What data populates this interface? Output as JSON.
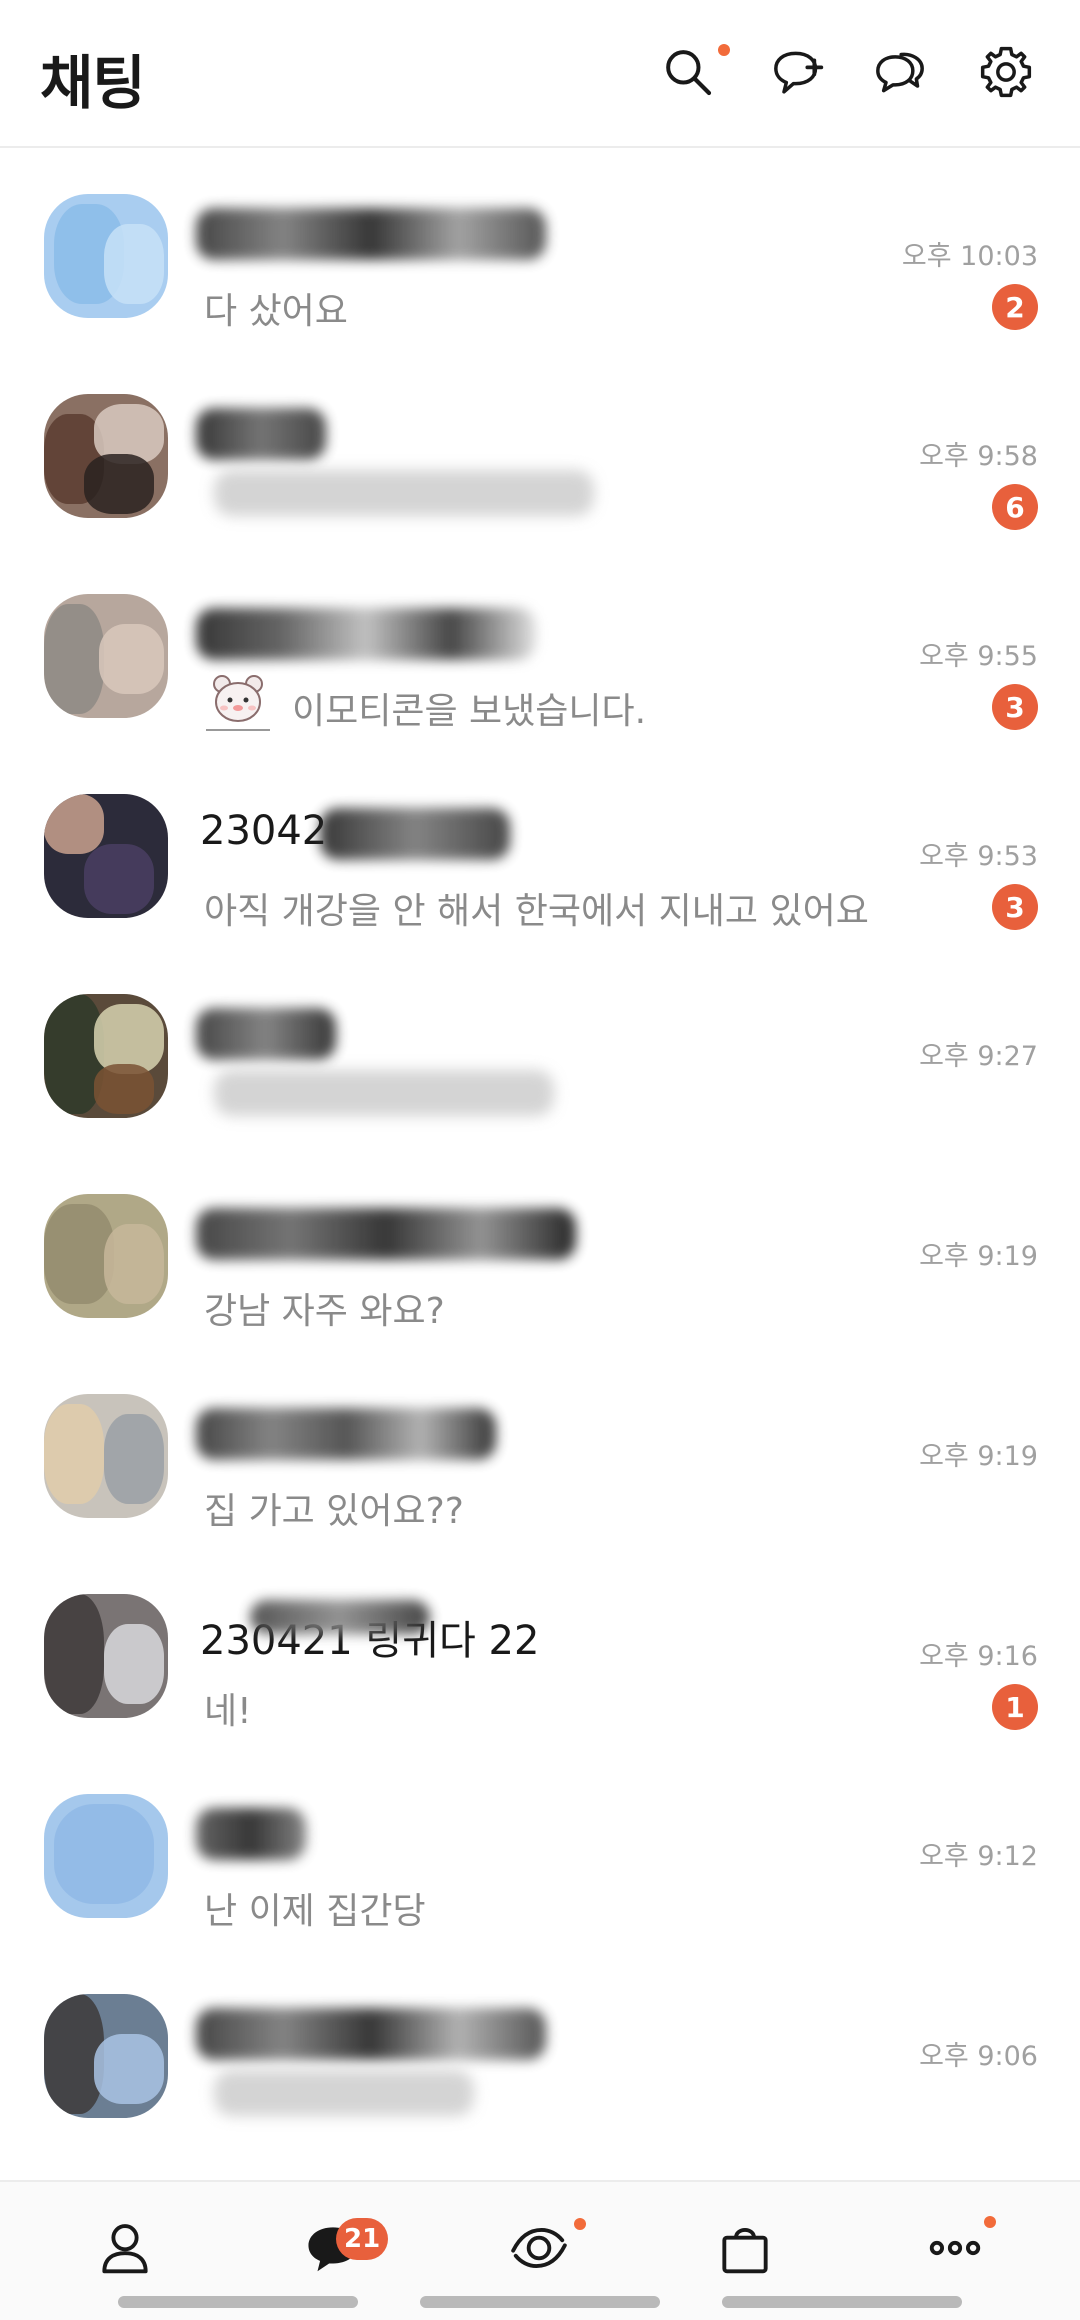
{
  "header": {
    "title": "채팅",
    "icons": [
      "search-icon",
      "new-chat-icon",
      "open-chat-icon",
      "settings-icon"
    ],
    "accent_color": "#f26b3a"
  },
  "chats": [
    {
      "name": "",
      "preview": "다 샀어요",
      "time": "오후 10:03",
      "badge": "2"
    },
    {
      "name": "",
      "preview": "",
      "time": "오후 9:58",
      "badge": "6"
    },
    {
      "name": "",
      "preview": "이모티콘을 보냈습니다.",
      "time": "오후 9:55",
      "badge": "3",
      "emoticon": true
    },
    {
      "name": "23042",
      "preview": "아직 개강을 안 해서 한국에서 지내고 있어요",
      "time": "오후 9:53",
      "badge": "3"
    },
    {
      "name": "",
      "preview": "",
      "time": "오후 9:27",
      "badge": ""
    },
    {
      "name": "",
      "preview": "강남 자주 와요?",
      "time": "오후 9:19",
      "badge": ""
    },
    {
      "name": "",
      "preview": "집 가고 있어요??",
      "time": "오후 9:19",
      "badge": ""
    },
    {
      "name": "230421 링귀다 22",
      "preview": "네!",
      "time": "오후 9:16",
      "badge": "1"
    },
    {
      "name": "",
      "preview": "난 이제 집간당",
      "time": "오후 9:12",
      "badge": ""
    },
    {
      "name": "",
      "preview": "",
      "time": "오후 9:06",
      "badge": ""
    }
  ],
  "bottom_nav": {
    "items": [
      "friends-icon",
      "chat-icon",
      "view-icon",
      "shopping-icon",
      "more-icon"
    ],
    "chat_badge": "21"
  },
  "colors": {
    "badge": "#e8603c",
    "time_text": "#a0a0a0",
    "preview_text": "#8a8a8a"
  }
}
